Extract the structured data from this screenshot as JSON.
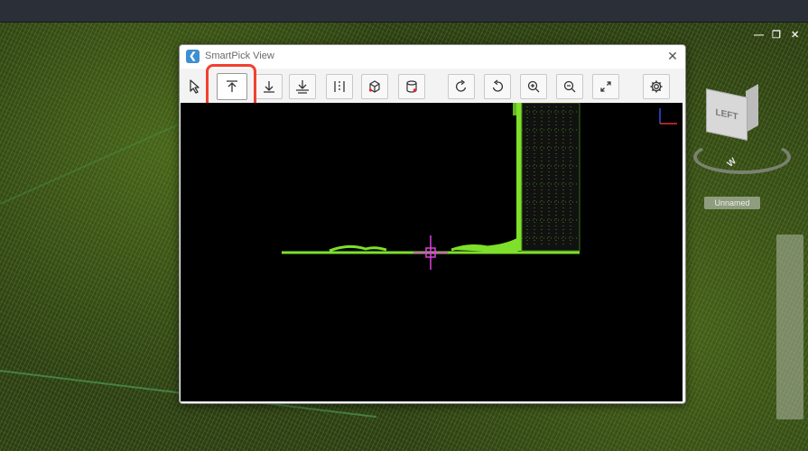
{
  "dialog": {
    "title": "SmartPick View",
    "close_glyph": "✕",
    "app_icon": "smartpick-app-icon"
  },
  "toolbar": {
    "buttons": [
      {
        "name": "select-tool-button",
        "icon": "cursor-arrow-icon",
        "active": false
      },
      {
        "name": "pick-top-button",
        "icon": "arrow-up-to-line-icon",
        "active": true
      },
      {
        "name": "pick-bottom-button",
        "icon": "arrow-down-to-line-icon",
        "active": false
      },
      {
        "name": "pick-ground-button",
        "icon": "arrow-down-to-double-line-icon",
        "active": false
      },
      {
        "name": "section-lines-button",
        "icon": "vertical-dashed-lines-icon",
        "active": false
      },
      {
        "name": "box-view-button",
        "icon": "cube-icon",
        "active": false
      },
      {
        "name": "cylinder-view-button",
        "icon": "cylinder-icon",
        "active": false
      },
      {
        "name": "rotate-cw-button",
        "icon": "rotate-clockwise-icon",
        "active": false
      },
      {
        "name": "rotate-ccw-button",
        "icon": "rotate-counterclockwise-icon",
        "active": false
      },
      {
        "name": "zoom-in-button",
        "icon": "zoom-in-icon",
        "active": false
      },
      {
        "name": "zoom-out-button",
        "icon": "zoom-out-icon",
        "active": false
      },
      {
        "name": "zoom-extents-button",
        "icon": "expand-diagonal-icon",
        "active": false
      },
      {
        "name": "settings-button",
        "icon": "gear-icon",
        "active": false
      }
    ]
  },
  "background": {
    "window_controls": [
      "—",
      "❐",
      "✕"
    ],
    "navcube_face_label": "LEFT",
    "navcube_compass_label": "W",
    "layer_label": "Unnamed"
  },
  "colors": {
    "point_cloud": "#7ee02a",
    "crosshair": "#e040e0",
    "highlight": "#f2402f",
    "axis_x": "#e53030",
    "axis_y": "#3050e0"
  }
}
